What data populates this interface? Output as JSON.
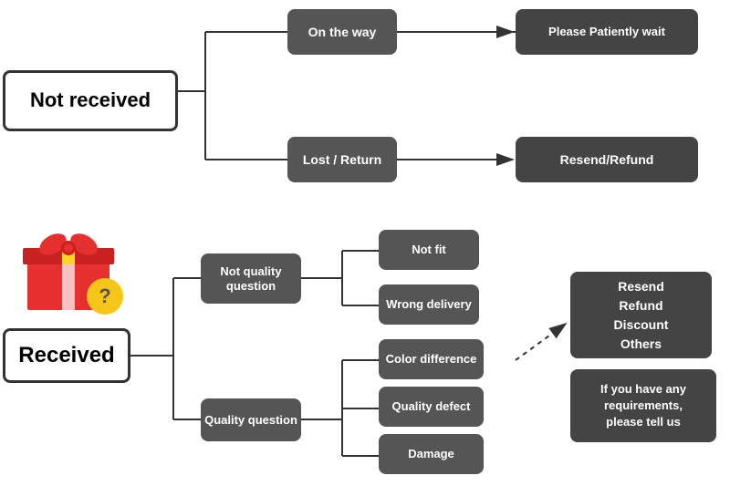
{
  "nodes": {
    "not_received": "Not received",
    "on_the_way": "On the way",
    "please_wait": "Please Patiently wait",
    "lost_return": "Lost / Return",
    "resend_refund_1": "Resend/Refund",
    "received": "Received",
    "not_quality_question": "Not quality\nquestion",
    "quality_question": "Quality question",
    "not_fit": "Not fit",
    "wrong_delivery": "Wrong delivery",
    "color_difference": "Color difference",
    "quality_defect": "Quality defect",
    "damage": "Damage",
    "resend_refund_2": "Resend\nRefund\nDiscount\nOthers",
    "if_you_have": "If you have any\nrequirements,\nplease tell us"
  },
  "icons": {
    "question_mark": "?"
  }
}
